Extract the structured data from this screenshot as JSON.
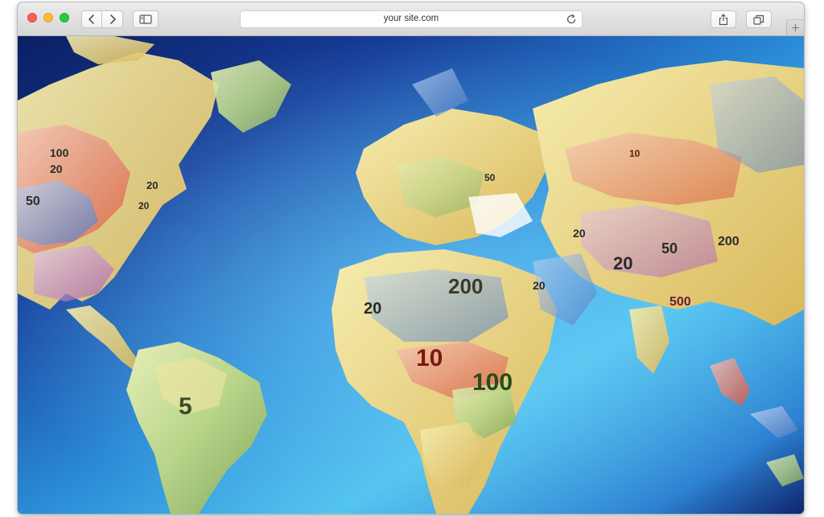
{
  "browser": {
    "address_bar": {
      "url": "your site.com"
    },
    "icons": {
      "back": "chevron-left-icon",
      "forward": "chevron-right-icon",
      "sidebar": "sidebar-icon",
      "reload": "reload-icon",
      "share": "share-icon",
      "tabs": "tabs-overview-icon",
      "new_tab": "plus-icon"
    },
    "colors": {
      "close": "#fc5f57",
      "minimize": "#fdbc2e",
      "zoom": "#28c840"
    }
  },
  "page": {
    "image_subject": "world map made of euro banknotes on a blue background",
    "background_colors": {
      "ocean_light": "#4fc2ee",
      "ocean_dark": "#10246e"
    },
    "banknote_labels": [
      "100",
      "20",
      "20",
      "50",
      "200",
      "20",
      "20",
      "10",
      "100",
      "20",
      "5",
      "50",
      "200",
      "10",
      "20",
      "50",
      "20",
      "500"
    ]
  }
}
